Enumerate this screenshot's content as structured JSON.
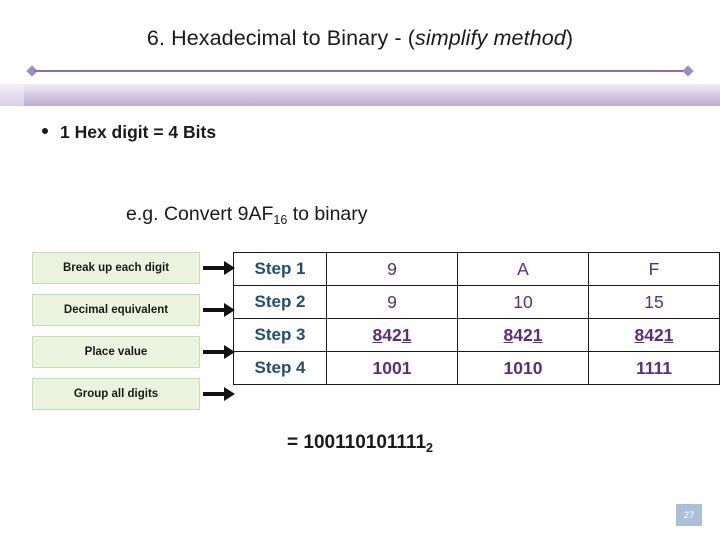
{
  "slide": {
    "title_main": "6. Hexadecimal to Binary - (",
    "title_italic": "simplify method",
    "title_close": ")",
    "bullet": "1 Hex digit = 4 Bits",
    "example_prefix": "e.g. Convert 9AF",
    "example_sub": "16",
    "example_suffix": " to binary",
    "result_text": "= 100110101111",
    "result_sub": "2",
    "page_number": "27",
    "accent_color": "#5a2d82",
    "step_color": "#1f4e79",
    "divider_color": "#8a6fb0",
    "label_bg": "#e9f3de"
  },
  "labels": [
    {
      "text": "Break up each digit"
    },
    {
      "text": "Decimal equivalent"
    },
    {
      "text": "Place value"
    },
    {
      "text": "Group all digits"
    }
  ],
  "table": {
    "rows": [
      {
        "step": "Step 1",
        "c1": "9",
        "c2": "A",
        "c3": "F"
      },
      {
        "step": "Step 2",
        "c1": "9",
        "c2": "10",
        "c3": "15"
      },
      {
        "step": "Step 3",
        "c1": "8421",
        "c2": "8421",
        "c3": "8421"
      },
      {
        "step": "Step 4",
        "c1": "1001",
        "c2": "1010",
        "c3": "1111"
      }
    ],
    "place_value_parts": {
      "p1": "8",
      "p2": "42",
      "p3": "1"
    }
  }
}
